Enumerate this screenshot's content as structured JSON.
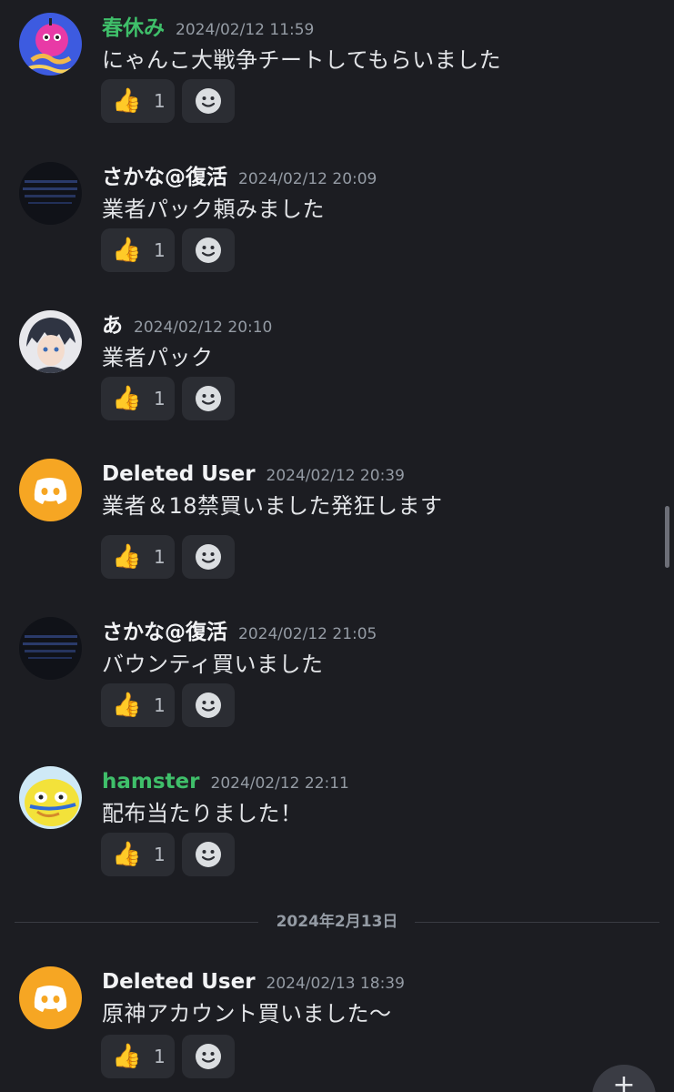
{
  "messages": [
    {
      "username": "春休み",
      "timestamp": "2024/02/12 11:59",
      "text": "にゃんこ大戦争チートしてもらいました",
      "reaction_emoji": "👍",
      "reaction_count": "1"
    },
    {
      "username": "さかな@復活",
      "timestamp": "2024/02/12 20:09",
      "text": "業者パック頼みました",
      "reaction_emoji": "👍",
      "reaction_count": "1"
    },
    {
      "username": "あ",
      "timestamp": "2024/02/12 20:10",
      "text": "業者パック",
      "reaction_emoji": "👍",
      "reaction_count": "1"
    },
    {
      "username": "Deleted User",
      "timestamp": "2024/02/12 20:39",
      "text": "業者＆18禁買いました発狂します",
      "reaction_emoji": "👍",
      "reaction_count": "1"
    },
    {
      "username": "さかな@復活",
      "timestamp": "2024/02/12 21:05",
      "text": "バウンティ買いました",
      "reaction_emoji": "👍",
      "reaction_count": "1"
    },
    {
      "username": "hamster",
      "timestamp": "2024/02/12 22:11",
      "text": "配布当たりました！",
      "reaction_emoji": "👍",
      "reaction_count": "1"
    },
    {
      "username": "Deleted User",
      "timestamp": "2024/02/13 18:39",
      "text": "原神アカウント買いました〜",
      "reaction_emoji": "👍",
      "reaction_count": "1"
    }
  ],
  "date_divider": "2024年2月13日",
  "fab_label": "+",
  "colors": {
    "background": "#1c1d22",
    "username_green": "#3fbf6a",
    "discord_orange": "#f6a623",
    "reaction_bg": "#2b2d33"
  }
}
